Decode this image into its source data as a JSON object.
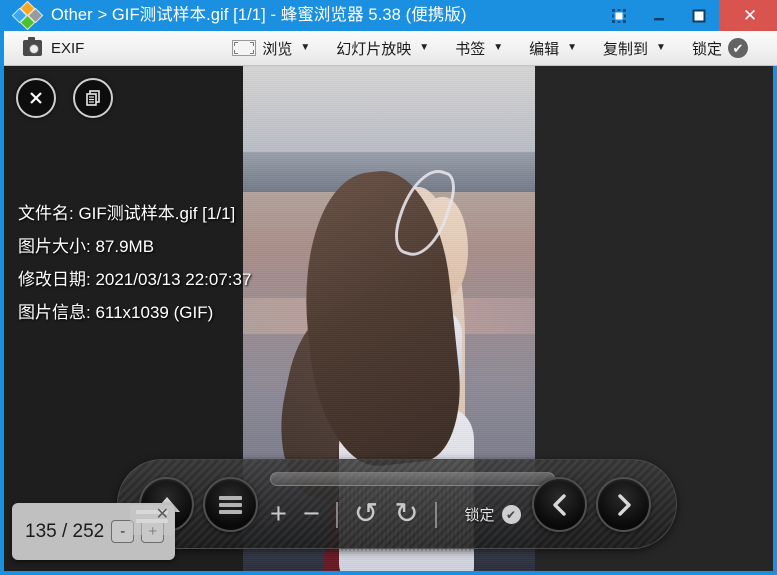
{
  "window": {
    "title": "Other > GIF测试样本.gif [1/1] - 蜂蜜浏览器 5.38 (便携版)",
    "accent_color": "#1b8fe0",
    "close_color": "#d9534f",
    "controls": {
      "always_on_top": "always-on-top",
      "minimize": "minimize",
      "maximize": "maximize",
      "close": "✕"
    }
  },
  "toolbar": {
    "exif_label": "EXIF",
    "items": [
      {
        "label": "浏览",
        "caret": "▼",
        "icon": "frame-icon"
      },
      {
        "label": "幻灯片放映",
        "caret": "▼",
        "icon": ""
      },
      {
        "label": "书签",
        "caret": "▼",
        "icon": ""
      },
      {
        "label": "编辑",
        "caret": "▼",
        "icon": ""
      },
      {
        "label": "复制到",
        "caret": "▼",
        "icon": ""
      },
      {
        "label": "锁定",
        "caret": "",
        "icon": "check-circle-icon"
      }
    ],
    "check_glyph": "✔"
  },
  "overlay": {
    "close_glyph": "✕",
    "copy_glyph": "❐",
    "lines": [
      "文件名: GIF测试样本.gif [1/1]",
      "图片大小: 87.9MB",
      "修改日期: 2021/03/13 22:07:37",
      "图片信息: 611x1039 (GIF)"
    ]
  },
  "bottombar": {
    "zoom_in": "+",
    "zoom_out": "−",
    "rotate_left": "↺",
    "rotate_right": "↻",
    "lock_label": "锁定",
    "lock_check": "✔",
    "prev_glyph": "❮",
    "next_glyph": "❯"
  },
  "page_popup": {
    "counter": "135 / 252",
    "decrement": "-",
    "increment": "+",
    "close": "✕"
  }
}
